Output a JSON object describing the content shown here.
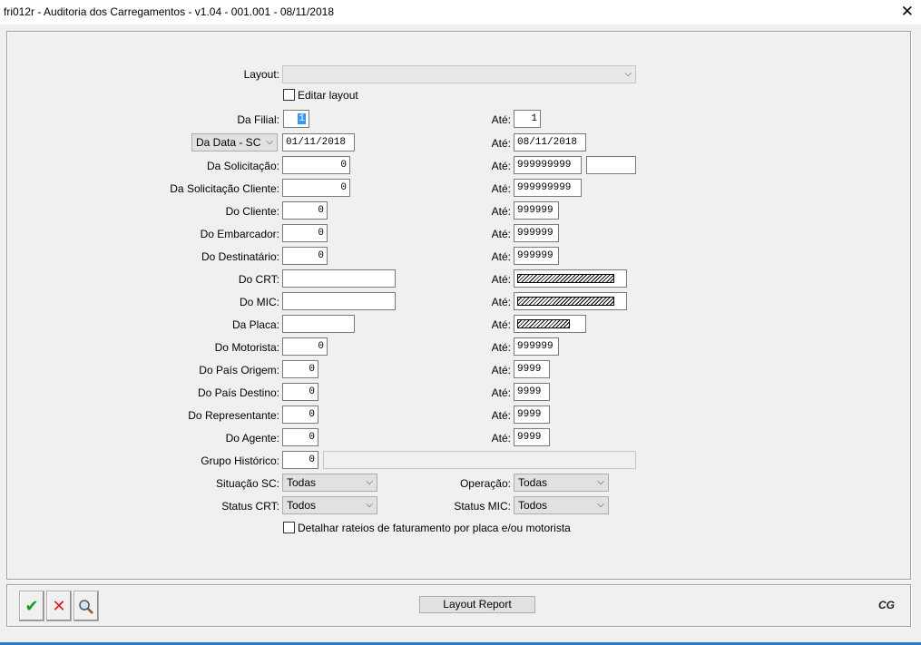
{
  "window": {
    "title": "fri012r - Auditoria dos Carregamentos - v1.04 - 001.001 - 08/11/2018",
    "close_icon": "close-icon"
  },
  "layout": {
    "label": "Layout:",
    "value": "",
    "edit_label": "Editar layout"
  },
  "filial": {
    "label": "Da Filial:",
    "from": "1",
    "to_label": "Até:",
    "to": "1"
  },
  "data": {
    "combo": "Da Data - SC",
    "from": "01/11/2018",
    "to_label": "Até:",
    "to": "08/11/2018"
  },
  "solicitacao": {
    "label": "Da Solicitação:",
    "from": "0",
    "to_label": "Até:",
    "to": "999999999",
    "extra": ""
  },
  "solicitacao_cliente": {
    "label": "Da Solicitação Cliente:",
    "from": "0",
    "to_label": "Até:",
    "to": "999999999"
  },
  "cliente": {
    "label": "Do Cliente:",
    "from": "0",
    "to_label": "Até:",
    "to": "999999"
  },
  "embarcador": {
    "label": "Do Embarcador:",
    "from": "0",
    "to_label": "Até:",
    "to": "999999"
  },
  "destinatario": {
    "label": "Do Destinatário:",
    "from": "0",
    "to_label": "Até:",
    "to": "999999"
  },
  "crt": {
    "label": "Do CRT:",
    "from": "",
    "to_label": "Até:"
  },
  "mic": {
    "label": "Do MIC:",
    "from": "",
    "to_label": "Até:"
  },
  "placa": {
    "label": "Da Placa:",
    "from": "",
    "to_label": "Até:"
  },
  "motorista": {
    "label": "Do Motorista:",
    "from": "0",
    "to_label": "Até:",
    "to": "999999"
  },
  "pais_origem": {
    "label": "Do País Origem:",
    "from": "0",
    "to_label": "Até:",
    "to": "9999"
  },
  "pais_destino": {
    "label": "Do País Destino:",
    "from": "0",
    "to_label": "Até:",
    "to": "9999"
  },
  "representante": {
    "label": "Do Representante:",
    "from": "0",
    "to_label": "Até:",
    "to": "9999"
  },
  "agente": {
    "label": "Do Agente:",
    "from": "0",
    "to_label": "Até:",
    "to": "9999"
  },
  "grupo_historico": {
    "label": "Grupo Histórico:",
    "value": "0",
    "description": ""
  },
  "situacao_sc": {
    "label": "Situação SC:",
    "value": "Todas"
  },
  "operacao": {
    "label": "Operação:",
    "value": "Todas"
  },
  "status_crt": {
    "label": "Status CRT:",
    "value": "Todos"
  },
  "status_mic": {
    "label": "Status MIC:",
    "value": "Todos"
  },
  "detalhar": {
    "label": "Detalhar rateios de faturamento por placa e/ou motorista"
  },
  "toolbar": {
    "confirm_icon": "checkmark-icon",
    "cancel_icon": "cancel-icon",
    "search_icon": "search-icon",
    "report_label": "Layout Report",
    "logo": "CG"
  },
  "colors": {
    "confirm": "#1a9a1a",
    "cancel": "#d42020",
    "selection": "#3399ff",
    "taskbar": "#2b79c2"
  }
}
